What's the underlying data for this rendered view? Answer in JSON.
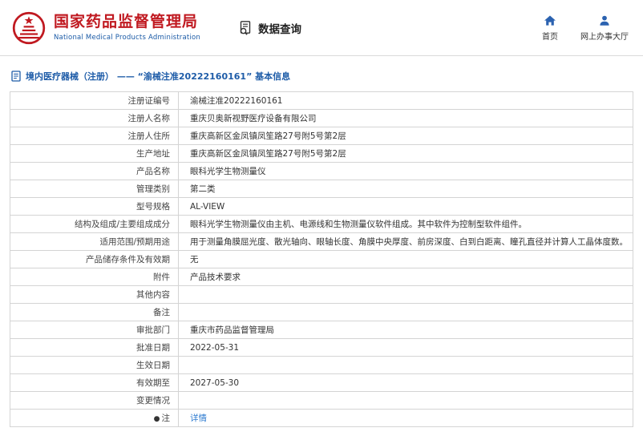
{
  "header": {
    "org_name_cn": "国家药品监督管理局",
    "org_name_en": "National Medical Products Administration",
    "data_query_label": "数据查询",
    "nav": [
      {
        "label": "首页",
        "icon": "home-icon"
      },
      {
        "label": "网上办事大厅",
        "icon": "user-icon"
      }
    ]
  },
  "breadcrumb": {
    "full_text": "境内医疗器械（注册） ——  “渝械注准20222160161” 基本信息"
  },
  "icons": {
    "note_bullet": "●"
  },
  "table": {
    "rows": [
      {
        "label": "注册证编号",
        "value": "渝械注准20222160161"
      },
      {
        "label": "注册人名称",
        "value": "重庆贝奥新视野医疗设备有限公司"
      },
      {
        "label": "注册人住所",
        "value": "重庆高新区金凤镇凤笙路27号附5号第2层"
      },
      {
        "label": "生产地址",
        "value": "重庆高新区金凤镇凤笙路27号附5号第2层"
      },
      {
        "label": "产品名称",
        "value": "眼科光学生物测量仪"
      },
      {
        "label": "管理类别",
        "value": "第二类"
      },
      {
        "label": "型号规格",
        "value": "AL-VIEW"
      },
      {
        "label": "结构及组成/主要组成成分",
        "value": "眼科光学生物测量仪由主机、电源线和生物测量仪软件组成。其中软件为控制型软件组件。"
      },
      {
        "label": "适用范围/预期用途",
        "value": "用于测量角膜屈光度、散光轴向、眼轴长度、角膜中央厚度、前房深度、白到白距离、瞳孔直径并计算人工晶体度数。"
      },
      {
        "label": "产品储存条件及有效期",
        "value": "无"
      },
      {
        "label": "附件",
        "value": "产品技术要求"
      },
      {
        "label": "其他内容",
        "value": ""
      },
      {
        "label": "备注",
        "value": ""
      },
      {
        "label": "审批部门",
        "value": "重庆市药品监督管理局"
      },
      {
        "label": "批准日期",
        "value": "2022-05-31"
      },
      {
        "label": "生效日期",
        "value": ""
      },
      {
        "label": "有效期至",
        "value": "2027-05-30"
      },
      {
        "label": "变更情况",
        "value": ""
      },
      {
        "label": "注",
        "value": "详情",
        "link": true,
        "bullet": true
      }
    ]
  },
  "colors": {
    "brand_red": "#c01920",
    "brand_blue": "#1a5aa6",
    "breadcrumb_blue": "#1e5ca8",
    "link_blue": "#2f7cd0",
    "border_gray": "#d4d4d4"
  }
}
